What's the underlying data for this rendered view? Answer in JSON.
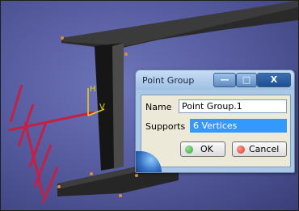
{
  "dialog": {
    "title": "Point Group",
    "buttons": {
      "minimize": "—",
      "maximize": "□",
      "close": "X"
    },
    "name_label": "Name",
    "name_value": "Point Group.1",
    "supports_label": "Supports",
    "supports_value": "6 Vertices",
    "ok_label": "OK",
    "cancel_label": "Cancel"
  },
  "axes": {
    "h_label": "H",
    "v_label": "V"
  },
  "colors": {
    "background": "#575da0",
    "beam": "#1c1c1c",
    "vertex": "#e6893a",
    "constraint": "#c42045",
    "axis": "#e8d020",
    "selection": "#3399ff",
    "ok_icon": "#2fa52f",
    "cancel_icon": "#d23a2a"
  }
}
